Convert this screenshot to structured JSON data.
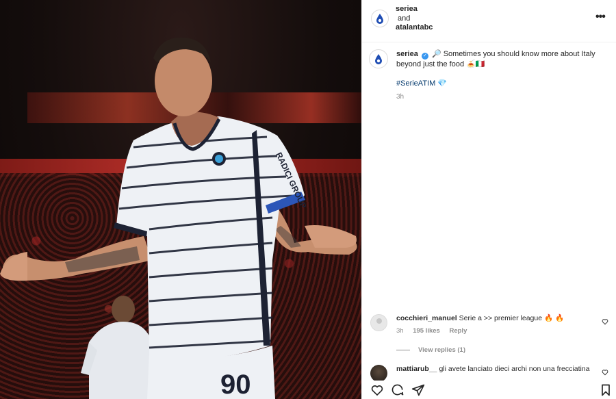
{
  "header": {
    "user1": "seriea",
    "conjunction": "and",
    "user2": "atalantabc"
  },
  "caption": {
    "username": "seriea",
    "verified_mark": "✓",
    "text": "🔎 Sometimes you should know more about Italy beyond just the food 🍝🇮🇹",
    "hashtag": "#SerieATIM 💎",
    "time": "3h"
  },
  "comments": [
    {
      "username": "cocchieri_manuel",
      "text": "Serie a >> premier league 🔥 🔥",
      "time": "3h",
      "likes": "195 likes",
      "reply_label": "Reply",
      "view_replies": "View replies (1)"
    },
    {
      "username": "mattiarub__",
      "text": "gli avete lanciato dieci archi non una frecciatina"
    }
  ],
  "photo": {
    "shirt_number": "90",
    "sponsor": "RADICI GROUP"
  },
  "icons": {
    "more": "more-icon",
    "like": "heart-icon",
    "comment": "comment-icon",
    "share": "share-icon",
    "save": "bookmark-icon"
  },
  "colors": {
    "link": "#00376b",
    "verified": "#3897f0",
    "muted": "#8e8e8e"
  }
}
